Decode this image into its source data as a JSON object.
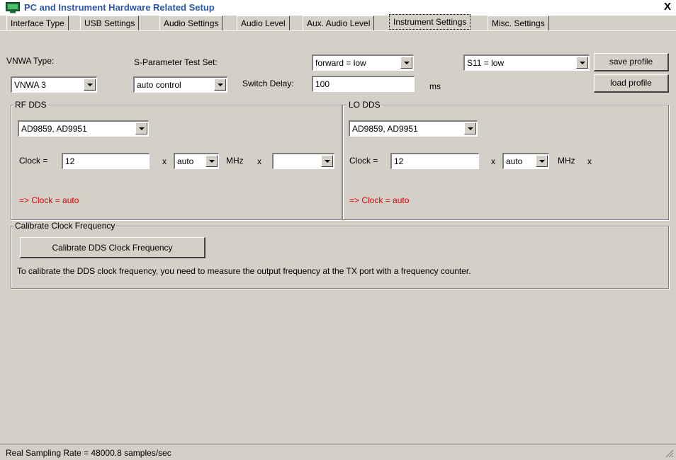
{
  "window": {
    "title": "PC and Instrument Hardware Related Setup",
    "close_glyph": "X"
  },
  "tabs": [
    {
      "label": "Interface Type"
    },
    {
      "label": "USB Settings"
    },
    {
      "label": "Audio Settings"
    },
    {
      "label": "Audio Level"
    },
    {
      "label": "Aux. Audio Level"
    },
    {
      "label": "Instrument Settings",
      "active": true
    },
    {
      "label": "Misc. Settings"
    }
  ],
  "vnwa": {
    "type_label": "VNWA Type:",
    "type_value": "VNWA 3"
  },
  "sparam": {
    "label": "S-Parameter Test Set:",
    "mode_value": "auto control",
    "forward_value": "forward = low",
    "s11_value": "S11 = low",
    "switch_delay_label": "Switch Delay:",
    "switch_delay_value": "100",
    "unit": "ms"
  },
  "profile": {
    "save_label": "save profile",
    "load_label": "load profile"
  },
  "rf_dds": {
    "title": "RF DDS",
    "chip_value": "AD9859, AD9951",
    "clock_label": "Clock =",
    "clock_value": "12",
    "x1": "x",
    "multiplier_value": "auto",
    "mhz": "MHz",
    "x2": "x",
    "extra_value": "",
    "result": "=> Clock = auto"
  },
  "lo_dds": {
    "title": "LO DDS",
    "chip_value": "AD9859, AD9951",
    "clock_label": "Clock =",
    "clock_value": "12",
    "x1": "x",
    "multiplier_value": "auto",
    "mhz": "MHz",
    "x2": "x",
    "result": "=> Clock = auto"
  },
  "calibrate": {
    "title": "Calibrate Clock Frequency",
    "button_label": "Calibrate DDS Clock Frequency",
    "description": "To calibrate the DDS clock frequency, you need to measure the output frequency at the TX port with a frequency counter."
  },
  "status": {
    "text": "Real Sampling Rate = 48000.8 samples/sec"
  },
  "colors": {
    "title_text": "#2b56a9",
    "warning": "#e0000b",
    "face": "#d4d0c8"
  },
  "icons": {
    "app": "instrument-monitor-icon",
    "close": "close-icon",
    "dropdown": "chevron-down-icon",
    "resize": "resize-grip-icon"
  }
}
